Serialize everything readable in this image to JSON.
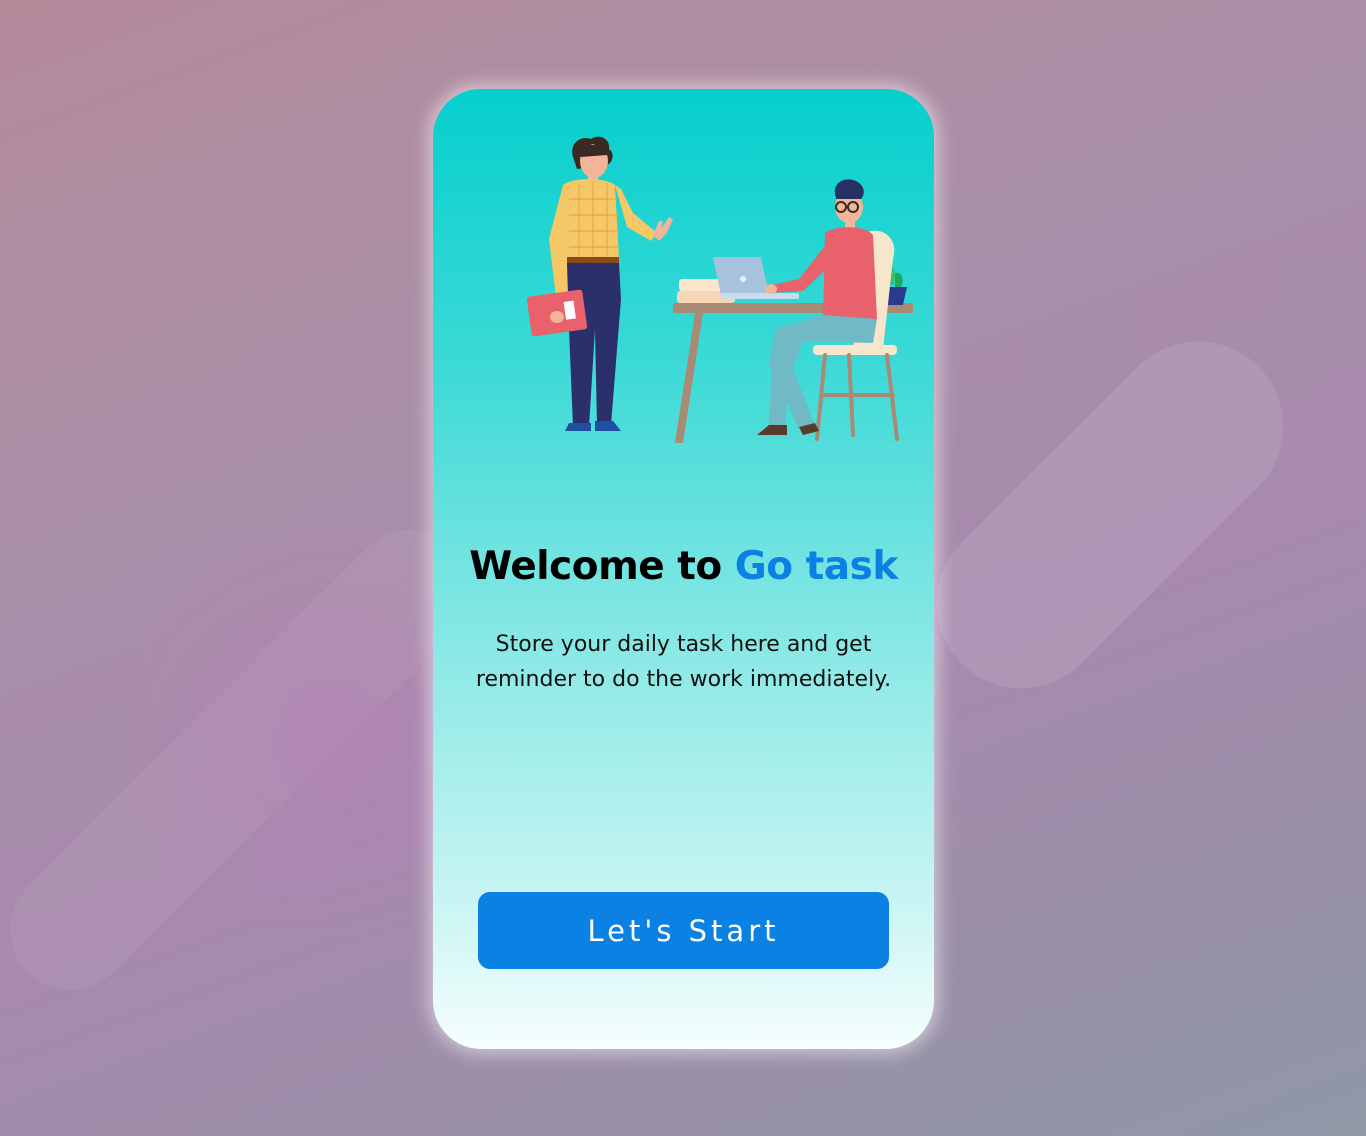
{
  "welcome": {
    "headline_prefix": "Welcome to",
    "brand_name": "Go task",
    "subtitle_line1": "Store your daily task here and get",
    "subtitle_line2": "reminder to do the work immediately.",
    "start_button_label": "Let's Start"
  },
  "illustration": {
    "subject": "two-people-office-scene"
  },
  "colors": {
    "brand": "#0b82e3",
    "card_top": "#05cfcd",
    "card_bottom": "#f6fefe"
  }
}
